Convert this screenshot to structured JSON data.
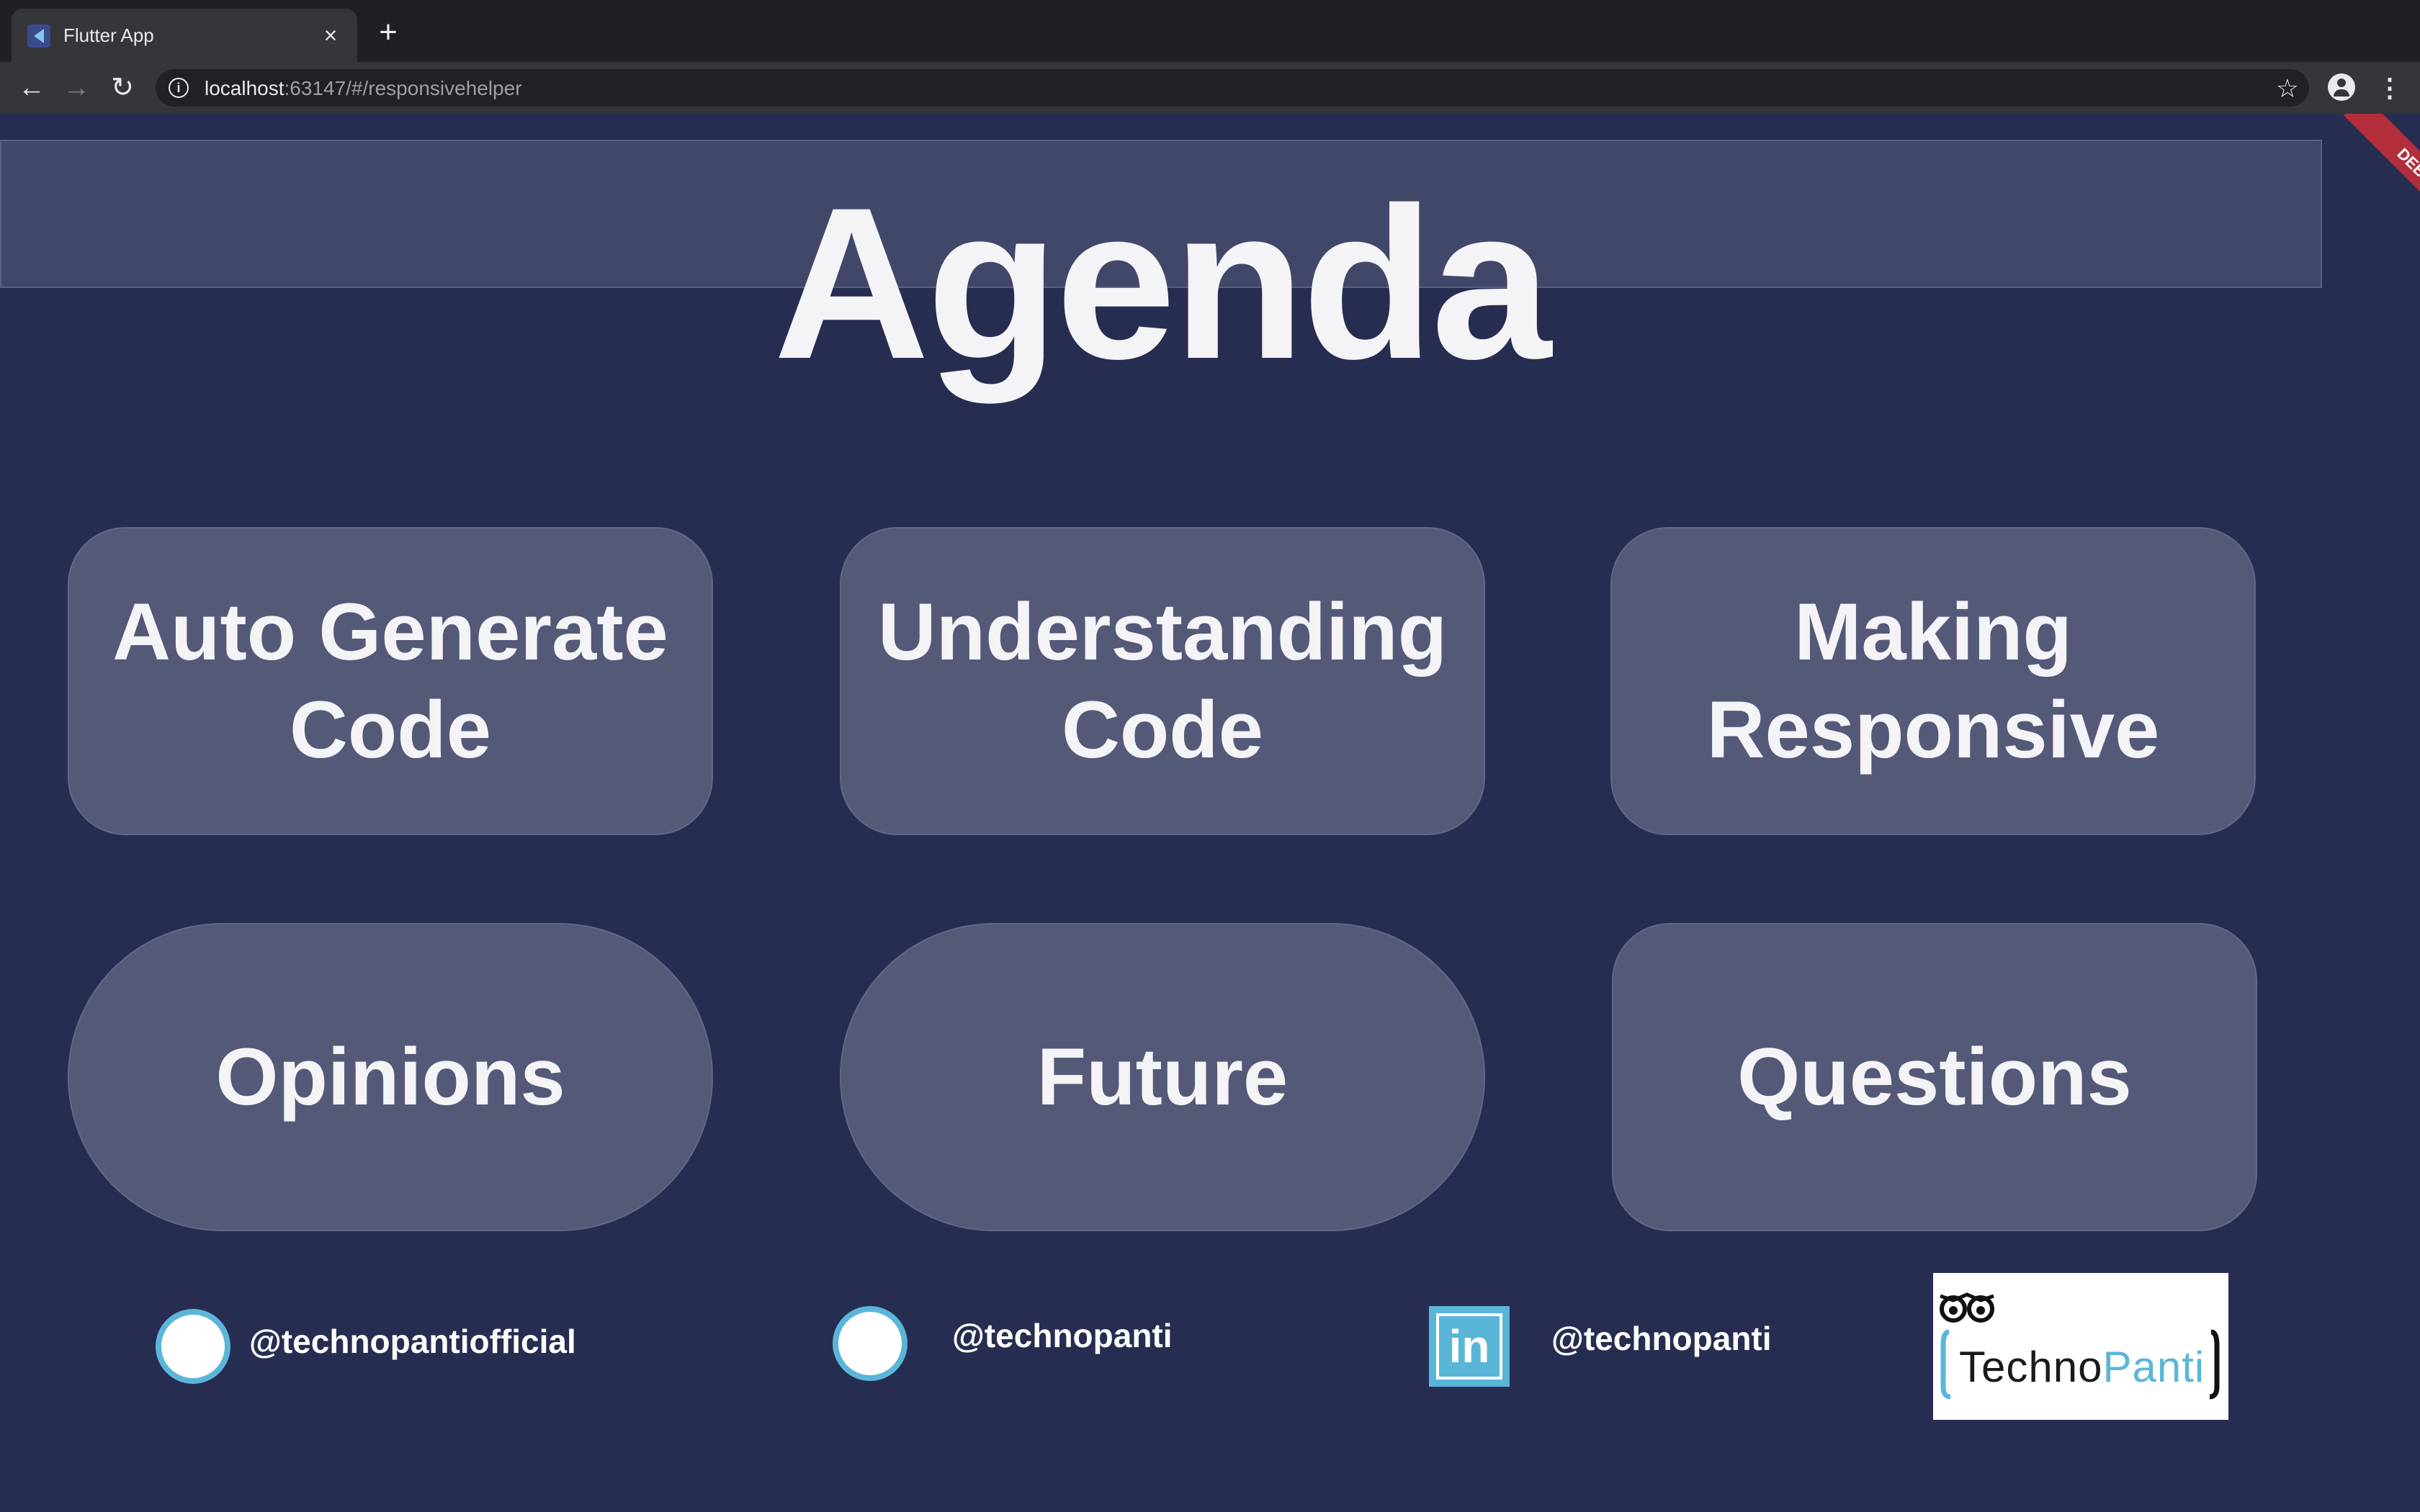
{
  "browser": {
    "tab_title": "Flutter App",
    "tab_close": "×",
    "new_tab": "+",
    "url_host": "localhost",
    "url_rest": ":63147/#/responsivehelper",
    "back": "←",
    "forward": "→",
    "reload": "↻",
    "bookmark": "☆",
    "menu": "⋮",
    "info": "i"
  },
  "page": {
    "title": "Agenda",
    "debug_banner": "DEBUG",
    "cards": [
      {
        "line1": "Auto Generate",
        "line2": "Code"
      },
      {
        "line1": "Understanding",
        "line2": "Code"
      },
      {
        "line1": "Making",
        "line2": "Responsive"
      },
      {
        "line1": "Opinions"
      },
      {
        "line1": "Future"
      },
      {
        "line1": "Questions"
      }
    ],
    "footer": {
      "handle_1": "@technopantiofficial",
      "handle_2": "@technopanti",
      "handle_3": "@technopanti",
      "linkedin_glyph": "in",
      "logo_text_1": "Techno",
      "logo_text_2": "Panti"
    }
  },
  "colors": {
    "background": "#262d50",
    "card": "#545978",
    "accent": "#5ab6d8",
    "debug": "#b22e3a"
  }
}
